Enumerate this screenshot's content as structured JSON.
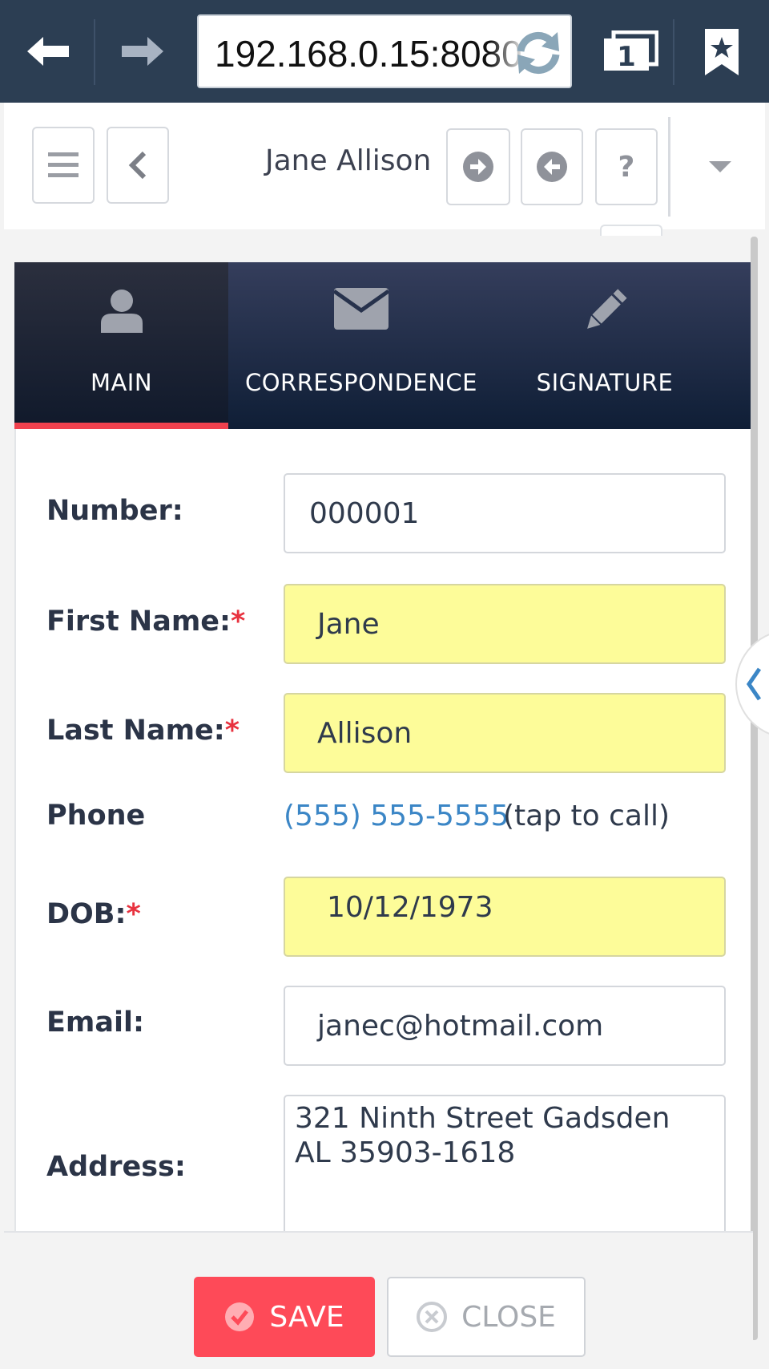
{
  "browser": {
    "url": "192.168.0.15:8080",
    "tab_count": "1",
    "colors": {
      "toolbar": "#2c3e53"
    }
  },
  "header": {
    "title": "Jane Allison"
  },
  "tabs": [
    {
      "label": "MAIN",
      "icon": "user-icon",
      "active": true
    },
    {
      "label": "CORRESPONDENCE",
      "icon": "envelope-icon",
      "active": false
    },
    {
      "label": "SIGNATURE",
      "icon": "pencil-icon",
      "active": false
    }
  ],
  "form": {
    "number": {
      "label": "Number:",
      "value": "000001"
    },
    "first_name": {
      "label": "First Name:",
      "required_mark": "*",
      "value": "Jane"
    },
    "last_name": {
      "label": "Last Name:",
      "required_mark": "*",
      "value": "Allison"
    },
    "phone": {
      "label": "Phone",
      "value": "(555) 555-5555",
      "hint": "(tap to call)"
    },
    "dob": {
      "label": "DOB:",
      "required_mark": "*",
      "value": "10/12/1973"
    },
    "email": {
      "label": "Email:",
      "value": "janec@hotmail.com"
    },
    "address": {
      "label": "Address:",
      "value": "321 Ninth Street Gadsden AL 35903-1618"
    }
  },
  "footer": {
    "save_label": "SAVE",
    "close_label": "CLOSE"
  },
  "colors": {
    "accent": "#fe4a58",
    "required_field": "#fdfc99",
    "link": "#3b86c6",
    "tab_bar": "#1d2a45"
  }
}
